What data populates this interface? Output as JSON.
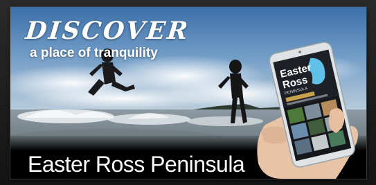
{
  "banner": {
    "headline": "DISCOVER",
    "tagline": "a place of tranquility",
    "caption": "Easter Ross Peninsula"
  },
  "phone_screen": {
    "logo_line1": "Easter",
    "logo_line2": "Ross",
    "logo_line3": "PENINSULA"
  }
}
